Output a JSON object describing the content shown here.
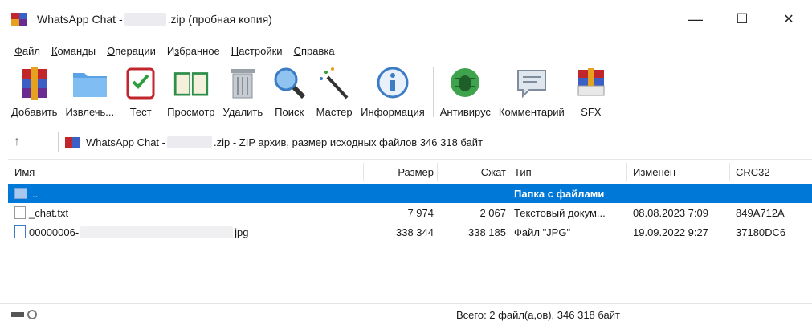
{
  "window": {
    "title_prefix": "WhatsApp Chat - ",
    "title_suffix": ".zip (пробная копия)",
    "minimize": "—",
    "maximize": "☐",
    "close": "✕"
  },
  "menu": [
    {
      "pre": "",
      "u": "Ф",
      "post": "айл"
    },
    {
      "pre": "",
      "u": "К",
      "post": "оманды"
    },
    {
      "pre": "",
      "u": "О",
      "post": "перации"
    },
    {
      "pre": "И",
      "u": "з",
      "post": "бранное"
    },
    {
      "pre": "",
      "u": "Н",
      "post": "астройки"
    },
    {
      "pre": "",
      "u": "С",
      "post": "правка"
    }
  ],
  "toolbar": {
    "add": "Добавить",
    "extract": "Извлечь...",
    "test": "Тест",
    "view": "Просмотр",
    "delete": "Удалить",
    "find": "Поиск",
    "wizard": "Мастер",
    "info": "Информация",
    "antivirus": "Антивирус",
    "comment": "Комментарий",
    "sfx": "SFX"
  },
  "path": {
    "prefix": "WhatsApp Chat - ",
    "suffix": ".zip - ZIP архив, размер исходных файлов 346 318 байт"
  },
  "columns": {
    "name": "Имя",
    "size": "Размер",
    "packed": "Сжат",
    "type": "Тип",
    "modified": "Изменён",
    "crc": "CRC32"
  },
  "rows": [
    {
      "name": "..",
      "size": "",
      "packed": "",
      "type": "Папка с файлами",
      "modified": "",
      "crc": ""
    },
    {
      "name": "_chat.txt",
      "size": "7 974",
      "packed": "2 067",
      "type": "Текстовый докум...",
      "modified": "08.08.2023 7:09",
      "crc": "849A712A"
    },
    {
      "name": "00000006-",
      "name_ext": "jpg",
      "size": "338 344",
      "packed": "338 185",
      "type": "Файл \"JPG\"",
      "modified": "19.09.2022 9:27",
      "crc": "37180DC6"
    }
  ],
  "status": {
    "summary": "Всего: 2 файл(а,ов), 346 318 байт"
  }
}
